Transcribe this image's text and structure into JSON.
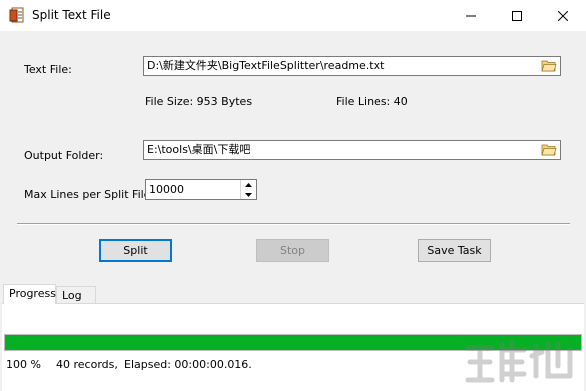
{
  "window": {
    "title": "Split Text File",
    "icon": "app-icon",
    "controls": [
      "minimize-icon",
      "maximize-icon",
      "close-icon"
    ]
  },
  "form": {
    "text_file_label": "Text File:",
    "text_file_value": "D:\\新建文件夹\\BigTextFileSplitter\\readme.txt",
    "file_size": "File Size: 953 Bytes",
    "file_lines": "File Lines: 40",
    "output_folder_label": "Output Folder:",
    "output_folder_value": "E:\\tools\\桌面\\下载吧",
    "max_lines_label": "Max Lines per Split File",
    "max_lines_value": "10000"
  },
  "buttons": {
    "split": "Split",
    "stop": "Stop",
    "save_task": "Save Task"
  },
  "tabs": [
    {
      "label": "Progress",
      "active": true
    },
    {
      "label": "Log",
      "active": false
    }
  ],
  "progress": {
    "fraction": 1.0,
    "color": "#06b025",
    "percent_text": "100 %",
    "records_text": "40 records,",
    "elapsed_text": "Elapsed: 00:00:00.016."
  }
}
